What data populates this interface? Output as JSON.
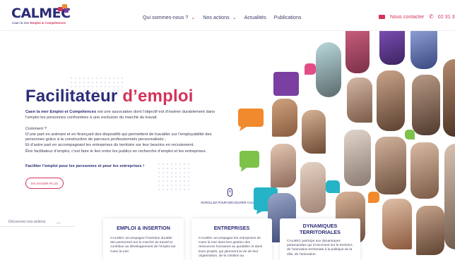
{
  "header": {
    "logo_text": "CALMEC",
    "logo_tagline_prefix": "Caen la mer ",
    "logo_tagline_bold": "Emploi & Compétences",
    "nav": [
      {
        "label": "Qui sommes-nous ?",
        "has_dropdown": true
      },
      {
        "label": "Nos actions",
        "has_dropdown": true
      },
      {
        "label": "Actualités",
        "has_dropdown": false
      },
      {
        "label": "Publications",
        "has_dropdown": false
      }
    ],
    "contact_label": "Nous contacter",
    "phone": "02 31 3"
  },
  "hero": {
    "title_main": "Facilitateur ",
    "title_accent": "d’emploi",
    "intro_bold": "Caen la mer Emploi et Compétences",
    "intro_rest": " est une association dont l’objectif est d’insérer durablement dans l’emploi les personnes confrontées à une exclusion du marché du travail.",
    "how_lead": "Comment ?",
    "how_1": "D’une part en animant et en finançant des dispositifs qui permettent de travailler sur l’employabilité des personnes grâce à la construction de parcours professionnels personnalisés ;",
    "how_2": "Et d’autre part en accompagnant les entreprises du territoire sur leur besoins en recrutement.",
    "being": "Être facilitateur d’emploi, c’est faire le lien entre les publics en recherche d’emploi et les entreprises.",
    "tagline": "Faciliter l’emploi pour les personnes et pour les entreprises !",
    "cta": "EN SAVOIR PLUS",
    "scroll_hint": "SCROLLEZ POUR DÉCOUVRIR CALMEC"
  },
  "side_tab": "Découvrez nos actions",
  "cards": [
    {
      "title": "EMPLOI & INSERTION",
      "text": "CALMEC accompagne l’insertion durable des personnes sur le marché du travail et contribue au développement de l’emploi sur Caen la mer."
    },
    {
      "title": "ENTREPRISES",
      "text": "CALMEC accompagne les entreprises de Caen la mer dans leur gestion des ressources humaines au quotidien et dans leurs projets, qui jalonnent la vie de leur organisation, de la création au"
    },
    {
      "title_line1": "DYNAMIQUES",
      "title_line2": "TERRITORIALES",
      "text": "CALMEC participe aux dynamiques partenariales qui s’inscrivent sur le territoire, de l’animation territoriale à la politique de la ville, de l’animation"
    }
  ],
  "colors": {
    "brand_navy": "#2c2c78",
    "brand_red": "#d4325a",
    "orange": "#f08a2c",
    "green": "#7ec24a",
    "teal": "#25b3c7",
    "purple": "#7a3fa0",
    "pink": "#e24d86"
  },
  "icons": {
    "mail": "mail-icon",
    "phone": "phone-icon",
    "scroll": "mouse-icon",
    "dropdown": "chevron-down-icon"
  }
}
